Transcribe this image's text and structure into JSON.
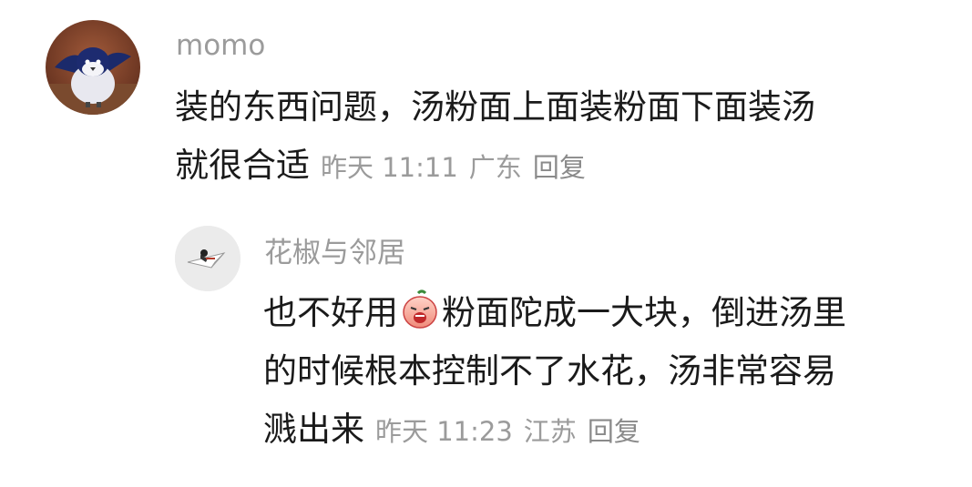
{
  "comment": {
    "username": "momo",
    "lines": [
      "装的东西问题，汤粉面上面装粉面下面装汤",
      "就很合适"
    ],
    "time": "昨天 11:11",
    "location": "广东",
    "reply_label": "回复"
  },
  "reply_comment": {
    "username": "花椒与邻居",
    "line1_before_emoji": "也不好用",
    "emoji_name": "crying-face-emoji",
    "line1_after_emoji": "粉面陀成一大块，倒进汤里",
    "line2": "的时候根本控制不了水花，汤非常容易",
    "line3": "溅出来",
    "time": "昨天 11:23",
    "location": "江苏",
    "reply_label": "回复"
  }
}
